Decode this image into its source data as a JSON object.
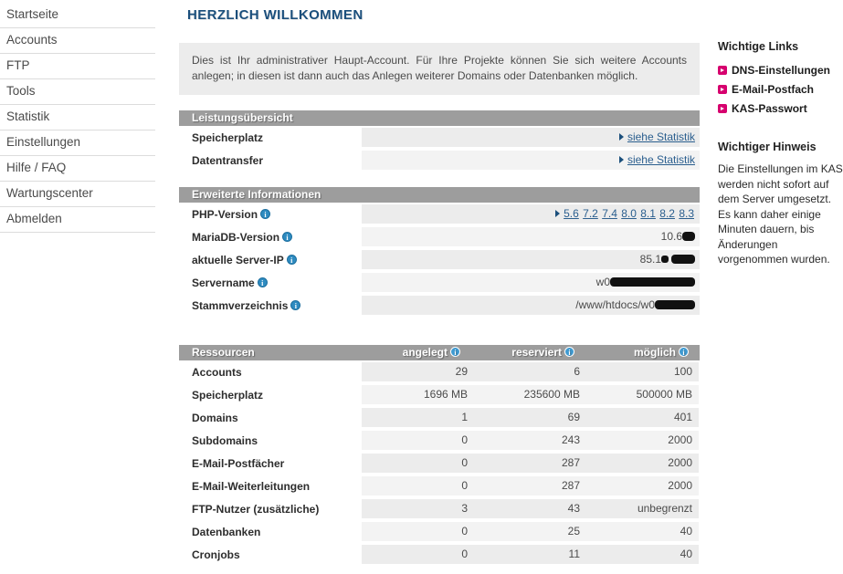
{
  "nav": {
    "items": [
      {
        "label": "Startseite",
        "key": "startseite"
      },
      {
        "label": "Accounts",
        "key": "accounts"
      },
      {
        "label": "FTP",
        "key": "ftp"
      },
      {
        "label": "Tools",
        "key": "tools"
      },
      {
        "label": "Statistik",
        "key": "statistik"
      },
      {
        "label": "Einstellungen",
        "key": "einstellungen"
      },
      {
        "label": "Hilfe / FAQ",
        "key": "hilfe-faq"
      },
      {
        "label": "Wartungscenter",
        "key": "wartungscenter"
      },
      {
        "label": "Abmelden",
        "key": "abmelden"
      }
    ]
  },
  "main": {
    "title": "HERZLICH WILLKOMMEN",
    "intro": "Dies ist Ihr administrativer Haupt-Account. Für Ihre Projekte können Sie sich weitere Accounts anlegen; in diesen ist dann auch das Anlegen weiterer Domains oder Datenbanken möglich.",
    "leistung": {
      "heading": "Leistungsübersicht",
      "rows": [
        {
          "label": "Speicherplatz",
          "link": "siehe Statistik"
        },
        {
          "label": "Datentransfer",
          "link": "siehe Statistik"
        }
      ]
    },
    "erweitert": {
      "heading": "Erweiterte Informationen",
      "php": {
        "label": "PHP-Version",
        "versions": [
          "5.6",
          "7.2",
          "7.4",
          "8.0",
          "8.1",
          "8.2",
          "8.3"
        ]
      },
      "mariadb": {
        "label": "MariaDB-Version",
        "value": "10.6"
      },
      "serverip": {
        "label": "aktuelle Server-IP",
        "value": "85.1"
      },
      "servername": {
        "label": "Servername",
        "value": "w0"
      },
      "stammverzeichnis": {
        "label": "Stammverzeichnis",
        "value": "/www/htdocs/w0"
      }
    },
    "ressourcen": {
      "heading": "Ressourcen",
      "columns": [
        "angelegt",
        "reserviert",
        "möglich"
      ],
      "rows": [
        {
          "name": "Accounts",
          "angelegt": "29",
          "reserviert": "6",
          "moeglich": "100"
        },
        {
          "name": "Speicherplatz",
          "angelegt": "1696 MB",
          "reserviert": "235600 MB",
          "moeglich": "500000 MB"
        },
        {
          "name": "Domains",
          "angelegt": "1",
          "reserviert": "69",
          "moeglich": "401"
        },
        {
          "name": "Subdomains",
          "angelegt": "0",
          "reserviert": "243",
          "moeglich": "2000"
        },
        {
          "name": "E-Mail-Postfächer",
          "angelegt": "0",
          "reserviert": "287",
          "moeglich": "2000"
        },
        {
          "name": "E-Mail-Weiterleitungen",
          "angelegt": "0",
          "reserviert": "287",
          "moeglich": "2000"
        },
        {
          "name": "FTP-Nutzer (zusätzliche)",
          "angelegt": "3",
          "reserviert": "43",
          "moeglich": "unbegrenzt"
        },
        {
          "name": "Datenbanken",
          "angelegt": "0",
          "reserviert": "25",
          "moeglich": "40"
        },
        {
          "name": "Cronjobs",
          "angelegt": "0",
          "reserviert": "11",
          "moeglich": "40"
        }
      ]
    }
  },
  "right": {
    "links_heading": "Wichtige Links",
    "links": [
      {
        "label": "DNS-Einstellungen",
        "key": "dns-einstellungen"
      },
      {
        "label": "E-Mail-Postfach",
        "key": "e-mail-postfach"
      },
      {
        "label": "KAS-Passwort",
        "key": "kas-passwort"
      }
    ],
    "notice_heading": "Wichtiger Hinweis",
    "notice_text": "Die Einstellungen im KAS werden nicht sofort auf dem Server umgesetzt. Es kann daher einige Minuten dauern, bis Änderungen vorgenommen wurden."
  },
  "icons": {
    "info": "i",
    "bullet": "arrow-bullet-icon",
    "marker": "triangle-marker-icon"
  },
  "colors": {
    "accent_blue": "#1b4f7c",
    "link_blue": "#2a5e8e",
    "header_gray": "#9d9d9d",
    "row_gray": "#ececec",
    "pink": "#d6006e",
    "info_blue": "#2e8bc0"
  }
}
